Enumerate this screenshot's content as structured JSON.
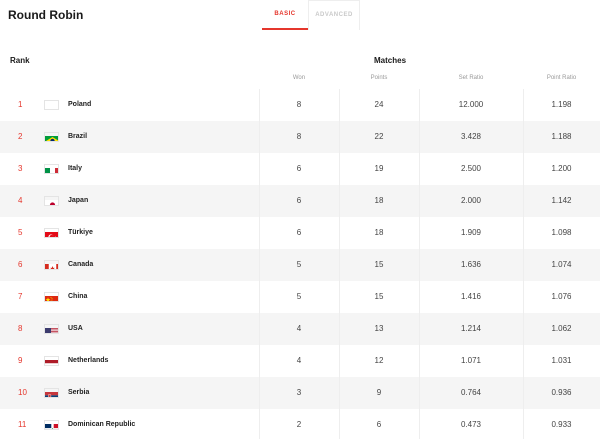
{
  "page": {
    "title": "Round Robin",
    "tabs": [
      {
        "label": "BASIC",
        "active": true
      },
      {
        "label": "ADVANCED",
        "active": false
      }
    ]
  },
  "table": {
    "rank_header": "Rank",
    "group_header": "Matches",
    "columns": [
      "Won",
      "Points",
      "Set Ratio",
      "Point Ratio"
    ],
    "rows": [
      {
        "rank": "1",
        "team": "Poland",
        "flag": "poland-flag-icon",
        "won": "8",
        "points": "24",
        "set_ratio": "12.000",
        "point_ratio": "1.198"
      },
      {
        "rank": "2",
        "team": "Brazil",
        "flag": "brazil-flag-icon",
        "won": "8",
        "points": "22",
        "set_ratio": "3.428",
        "point_ratio": "1.188"
      },
      {
        "rank": "3",
        "team": "Italy",
        "flag": "italy-flag-icon",
        "won": "6",
        "points": "19",
        "set_ratio": "2.500",
        "point_ratio": "1.200"
      },
      {
        "rank": "4",
        "team": "Japan",
        "flag": "japan-flag-icon",
        "won": "6",
        "points": "18",
        "set_ratio": "2.000",
        "point_ratio": "1.142"
      },
      {
        "rank": "5",
        "team": "Türkiye",
        "flag": "turkiye-flag-icon",
        "won": "6",
        "points": "18",
        "set_ratio": "1.909",
        "point_ratio": "1.098"
      },
      {
        "rank": "6",
        "team": "Canada",
        "flag": "canada-flag-icon",
        "won": "5",
        "points": "15",
        "set_ratio": "1.636",
        "point_ratio": "1.074"
      },
      {
        "rank": "7",
        "team": "China",
        "flag": "china-flag-icon",
        "won": "5",
        "points": "15",
        "set_ratio": "1.416",
        "point_ratio": "1.076"
      },
      {
        "rank": "8",
        "team": "USA",
        "flag": "usa-flag-icon",
        "won": "4",
        "points": "13",
        "set_ratio": "1.214",
        "point_ratio": "1.062"
      },
      {
        "rank": "9",
        "team": "Netherlands",
        "flag": "netherlands-flag-icon",
        "won": "4",
        "points": "12",
        "set_ratio": "1.071",
        "point_ratio": "1.031"
      },
      {
        "rank": "10",
        "team": "Serbia",
        "flag": "serbia-flag-icon",
        "won": "3",
        "points": "9",
        "set_ratio": "0.764",
        "point_ratio": "0.936"
      },
      {
        "rank": "11",
        "team": "Dominican Republic",
        "flag": "dominican-republic-flag-icon",
        "won": "2",
        "points": "6",
        "set_ratio": "0.473",
        "point_ratio": "0.933"
      }
    ]
  },
  "colors": {
    "accent": "#e5362c",
    "row_alt": "#f5f5f5",
    "muted_text": "#9a9a9a"
  }
}
